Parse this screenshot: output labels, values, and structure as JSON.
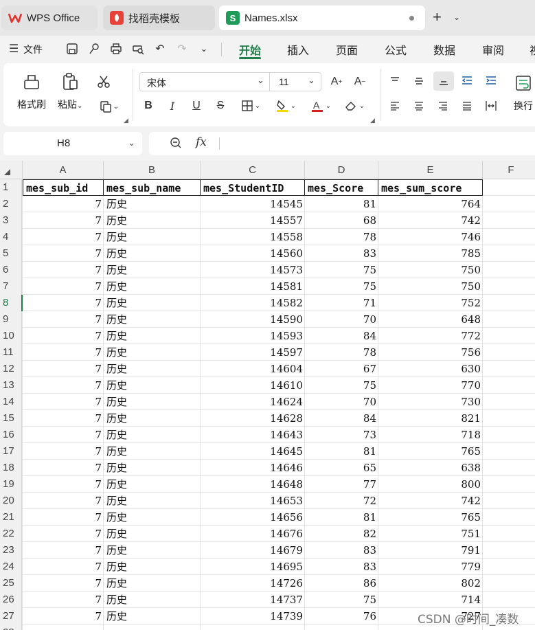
{
  "tabs": [
    {
      "label": "WPS Office",
      "logo": "W"
    },
    {
      "label": "找稻壳模板",
      "logo": "D"
    },
    {
      "label": "Names.xlsx",
      "logo": "S"
    }
  ],
  "menu": {
    "file": "文件",
    "items": [
      "开始",
      "插入",
      "页面",
      "公式",
      "数据",
      "审阅",
      "视"
    ],
    "active": "开始"
  },
  "ribbon": {
    "format_painter": "格式刷",
    "paste": "粘贴",
    "font_name": "宋体",
    "font_size": "11",
    "wrap": "换行",
    "bold": "B",
    "italic": "I",
    "underline": "U",
    "strike": "S",
    "font_color_letter": "A"
  },
  "formula_bar": {
    "cell_ref": "H8",
    "fx_label": "fx",
    "formula": ""
  },
  "columns": [
    "A",
    "B",
    "C",
    "D",
    "E",
    "F"
  ],
  "sheet": {
    "headers": [
      "mes_sub_id",
      "mes_sub_name",
      "mes_StudentID",
      "mes_Score",
      "mes_sum_score"
    ],
    "rows": [
      [
        "7",
        "历史",
        "14545",
        "81",
        "764"
      ],
      [
        "7",
        "历史",
        "14557",
        "68",
        "742"
      ],
      [
        "7",
        "历史",
        "14558",
        "78",
        "746"
      ],
      [
        "7",
        "历史",
        "14560",
        "83",
        "785"
      ],
      [
        "7",
        "历史",
        "14573",
        "75",
        "750"
      ],
      [
        "7",
        "历史",
        "14581",
        "75",
        "750"
      ],
      [
        "7",
        "历史",
        "14582",
        "71",
        "752"
      ],
      [
        "7",
        "历史",
        "14590",
        "70",
        "648"
      ],
      [
        "7",
        "历史",
        "14593",
        "84",
        "772"
      ],
      [
        "7",
        "历史",
        "14597",
        "78",
        "756"
      ],
      [
        "7",
        "历史",
        "14604",
        "67",
        "630"
      ],
      [
        "7",
        "历史",
        "14610",
        "75",
        "770"
      ],
      [
        "7",
        "历史",
        "14624",
        "70",
        "730"
      ],
      [
        "7",
        "历史",
        "14628",
        "84",
        "821"
      ],
      [
        "7",
        "历史",
        "14643",
        "73",
        "718"
      ],
      [
        "7",
        "历史",
        "14645",
        "81",
        "765"
      ],
      [
        "7",
        "历史",
        "14646",
        "65",
        "638"
      ],
      [
        "7",
        "历史",
        "14648",
        "77",
        "800"
      ],
      [
        "7",
        "历史",
        "14653",
        "72",
        "742"
      ],
      [
        "7",
        "历史",
        "14656",
        "81",
        "765"
      ],
      [
        "7",
        "历史",
        "14676",
        "82",
        "751"
      ],
      [
        "7",
        "历史",
        "14679",
        "83",
        "791"
      ],
      [
        "7",
        "历史",
        "14695",
        "83",
        "779"
      ],
      [
        "7",
        "历史",
        "14726",
        "86",
        "802"
      ],
      [
        "7",
        "历史",
        "14737",
        "75",
        "714"
      ],
      [
        "7",
        "历史",
        "14739",
        "76",
        "727"
      ]
    ]
  },
  "active_row": "8",
  "watermark": "CSDN @时间_凑数",
  "colors": {
    "accent": "#1d7c47",
    "sheet_logo": "#1e9a59",
    "wps_logo": "#e5302d"
  }
}
